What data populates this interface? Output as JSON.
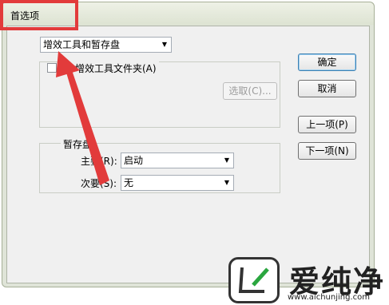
{
  "window": {
    "title": "首选项"
  },
  "pane_select": {
    "value": "增效工具和暂存盘"
  },
  "plugins_group": {
    "checkbox_label": "附加的增效工具文件夹(A)",
    "checkbox_label_visible": "增效工具文件夹(A)",
    "checked": false,
    "choose_button": "选取(C)..."
  },
  "buttons": {
    "ok": "确定",
    "cancel": "取消",
    "prev": "上一项(P)",
    "next": "下一项(N)"
  },
  "scratch_group": {
    "title": "暂存盘",
    "first_label": "主要(R):",
    "first_value": "启动",
    "second_label": "次要(S):",
    "second_value": "无"
  },
  "watermark": {
    "brand": "爱纯净",
    "url": "www.aichunjing.com"
  },
  "colors": {
    "highlight": "#e23b3b",
    "window_bg": "#dfe4d8",
    "client_bg": "#f0f0f0"
  }
}
